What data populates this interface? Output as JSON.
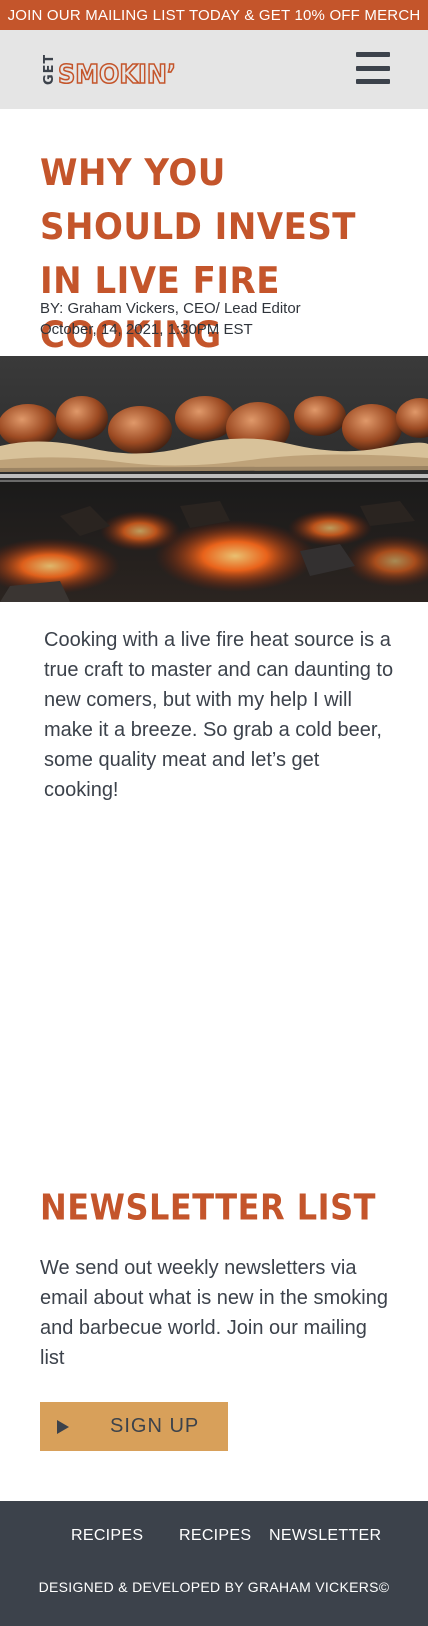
{
  "banner": {
    "text": "JOIN OUR MAILING LIST TODAY & GET 10% OFF MERCH"
  },
  "header": {
    "logo": {
      "prefix": "GET",
      "word": "SMOKIN’"
    },
    "menu_icon": "hamburger-menu-icon"
  },
  "article": {
    "title": "WHY YOU SHOULD INVEST IN LIVE FIRE COOKING",
    "byline": "BY: Graham Vickers, CEO/ Lead Editor",
    "date": "October, 14, 2021, 1:30PM EST",
    "hero_image": "grilled-sausages-over-embers",
    "intro": "Cooking with a live fire heat source is a true craft to master and can daunting to new comers, but with my help I will make it a breeze. So grab a cold beer, some quality meat and let’s get cooking!"
  },
  "newsletter": {
    "heading": "NEWSLETTER LIST",
    "text": "We send out weekly newsletters via email about what is new in the smoking and barbecue world. Join our mailing list",
    "button_label": "SIGN UP",
    "button_icon": "play-icon"
  },
  "footer": {
    "links": [
      "RECIPES",
      "RECIPES",
      "NEWSLETTER"
    ],
    "credit": "DESIGNED & DEVELOPED BY GRAHAM VICKERS©"
  },
  "colors": {
    "accent": "#c4552b",
    "header_bg": "#e5e5e5",
    "dark": "#3c424b",
    "button": "#d8a05a"
  }
}
